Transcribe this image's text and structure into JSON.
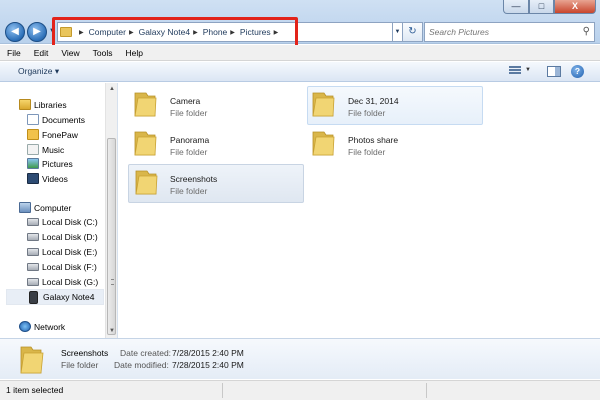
{
  "window": {
    "minimize_glyph": "—",
    "maximize_glyph": "□",
    "close_glyph": "X"
  },
  "address_bar": {
    "breadcrumbs": [
      "Computer",
      "Galaxy Note4",
      "Phone",
      "Pictures"
    ],
    "highlight_color": "#e2231a"
  },
  "search": {
    "placeholder": "Search Pictures"
  },
  "menu": {
    "items": [
      "File",
      "Edit",
      "View",
      "Tools",
      "Help"
    ]
  },
  "toolbar": {
    "organize_label": "Organize ▾"
  },
  "nav": {
    "libraries": {
      "label": "Libraries",
      "items": [
        "Documents",
        "FonePaw",
        "Music",
        "Pictures",
        "Videos"
      ]
    },
    "computer": {
      "label": "Computer",
      "items": [
        "Local Disk (C:)",
        "Local Disk (D:)",
        "Local Disk (E:)",
        "Local Disk (F:)",
        "Local Disk (G:)",
        "Galaxy Note4"
      ]
    },
    "network": {
      "label": "Network"
    }
  },
  "folders": [
    {
      "name": "Camera",
      "type": "File folder"
    },
    {
      "name": "Dec 31, 2014",
      "type": "File folder"
    },
    {
      "name": "Panorama",
      "type": "File folder"
    },
    {
      "name": "Photos share",
      "type": "File folder"
    },
    {
      "name": "Screenshots",
      "type": "File folder"
    }
  ],
  "details": {
    "name": "Screenshots",
    "type": "File folder",
    "created_label": "Date created:",
    "created_value": "7/28/2015 2:40 PM",
    "modified_label": "Date modified:",
    "modified_value": "7/28/2015 2:40 PM"
  },
  "status": {
    "text": "1 item selected"
  }
}
